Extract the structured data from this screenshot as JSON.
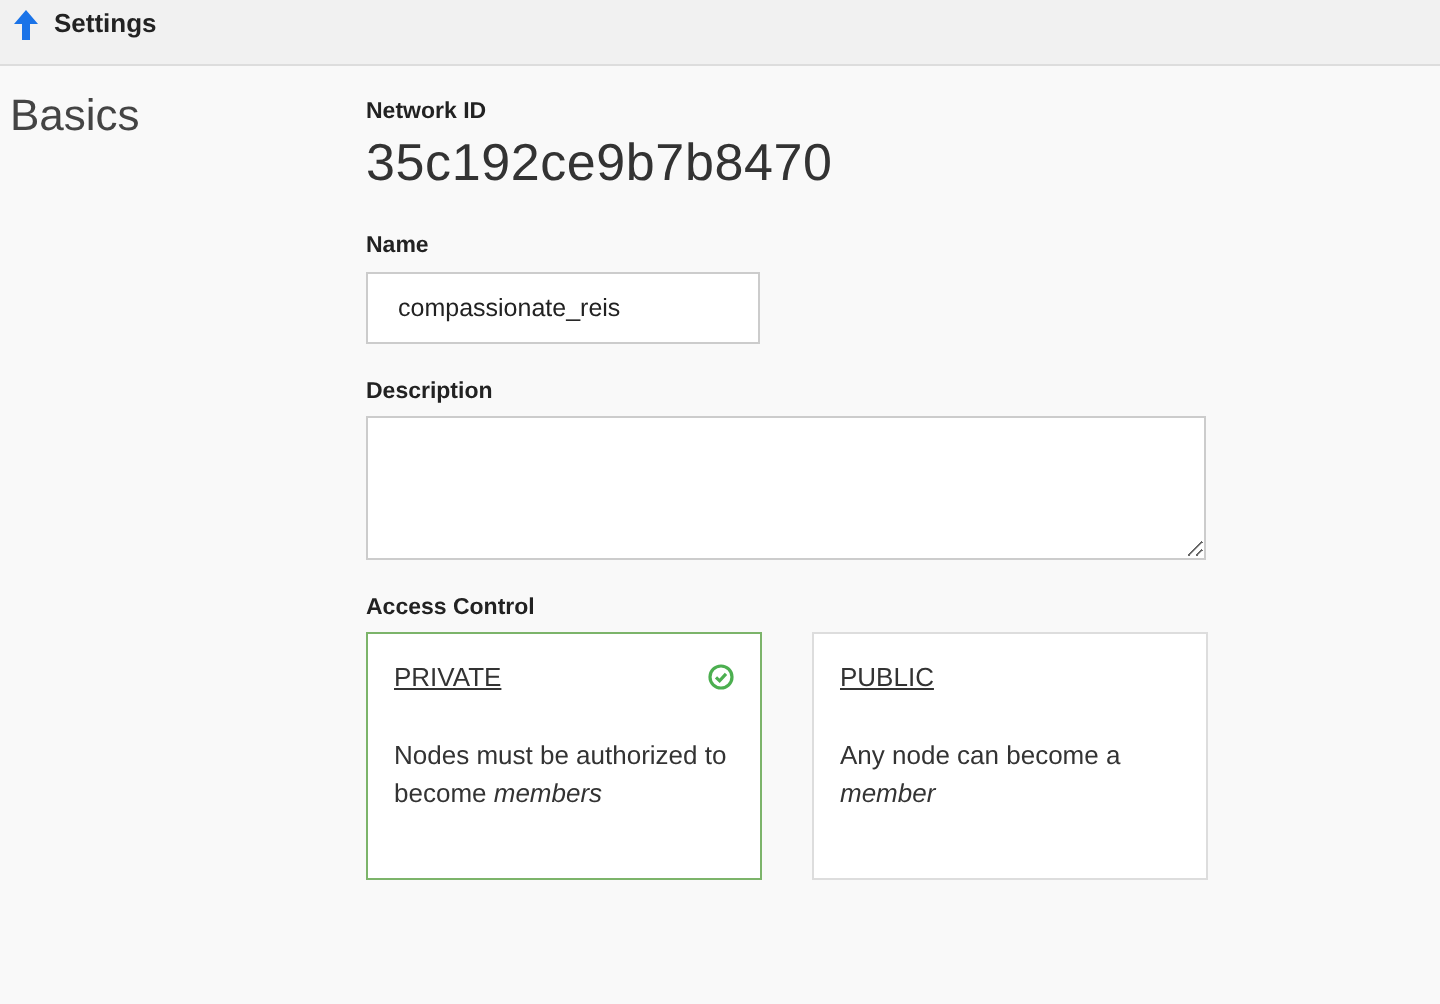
{
  "header": {
    "title": "Settings"
  },
  "section": {
    "title": "Basics"
  },
  "network_id": {
    "label": "Network ID",
    "value": "35c192ce9b7b8470"
  },
  "name": {
    "label": "Name",
    "value": "compassionate_reis"
  },
  "description": {
    "label": "Description"
  },
  "access_control": {
    "label": "Access Control",
    "options": [
      {
        "title": "PRIVATE",
        "text": "Nodes must be authorized to become *members*",
        "selected": true
      },
      {
        "title": "PUBLIC",
        "text": "Any node can become a *member*",
        "selected": false
      }
    ]
  }
}
